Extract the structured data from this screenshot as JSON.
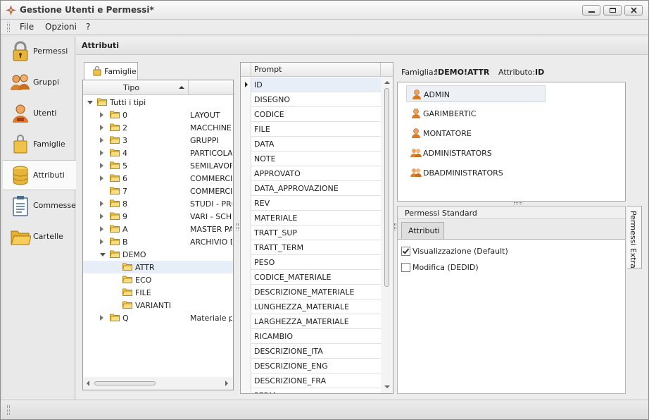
{
  "window": {
    "title": "Gestione Utenti e Permessi*"
  },
  "menu": [
    "File",
    "Opzioni",
    "?"
  ],
  "sidebar": {
    "items": [
      {
        "label": "Permessi",
        "icon": "lock-icon"
      },
      {
        "label": "Gruppi",
        "icon": "group-icon"
      },
      {
        "label": "Utenti",
        "icon": "user-icon"
      },
      {
        "label": "Famiglie",
        "icon": "family-icon"
      },
      {
        "label": "Attributi",
        "icon": "database-icon",
        "active": true
      },
      {
        "label": "Commesse",
        "icon": "clipboard-icon"
      },
      {
        "label": "Cartelle",
        "icon": "folder-icon"
      }
    ]
  },
  "content": {
    "title": "Attributi"
  },
  "tree": {
    "tab_label": "Famiglie",
    "column_label": "Tipo",
    "rows": [
      {
        "code": "Tutti i tipi",
        "desc": "",
        "level": 0,
        "state": "open"
      },
      {
        "code": "0",
        "desc": "LAYOUT",
        "level": 1,
        "state": "closed"
      },
      {
        "code": "2",
        "desc": "MACCHINE",
        "level": 1,
        "state": "closed"
      },
      {
        "code": "3",
        "desc": "GRUPPI",
        "level": 1,
        "state": "closed"
      },
      {
        "code": "4",
        "desc": "PARTICOLARI",
        "level": 1,
        "state": "closed"
      },
      {
        "code": "5",
        "desc": "SEMILAVORATI",
        "level": 1,
        "state": "closed"
      },
      {
        "code": "6",
        "desc": "COMMERCIALI",
        "level": 1,
        "state": "closed"
      },
      {
        "code": "7",
        "desc": "COMMERCIALI",
        "level": 1,
        "state": "none"
      },
      {
        "code": "8",
        "desc": "STUDI - PROGETTI",
        "level": 1,
        "state": "closed"
      },
      {
        "code": "9",
        "desc": "VARI - SCHEMI",
        "level": 1,
        "state": "closed"
      },
      {
        "code": "A",
        "desc": "MASTER PARTS",
        "level": 1,
        "state": "closed"
      },
      {
        "code": "B",
        "desc": "ARCHIVIO DISEGNI",
        "level": 1,
        "state": "closed"
      },
      {
        "code": "DEMO",
        "desc": "",
        "level": 1,
        "state": "open"
      },
      {
        "code": "ATTR",
        "desc": "",
        "level": 2,
        "state": "none",
        "selected": true
      },
      {
        "code": "ECO",
        "desc": "",
        "level": 2,
        "state": "none"
      },
      {
        "code": "FILE",
        "desc": "",
        "level": 2,
        "state": "none"
      },
      {
        "code": "VARIANTI",
        "desc": "",
        "level": 2,
        "state": "none"
      },
      {
        "code": "Q",
        "desc": "Materiale per",
        "level": 1,
        "state": "closed"
      }
    ]
  },
  "grid": {
    "column_label": "Prompt",
    "rows": [
      "ID",
      "DISEGNO",
      "CODICE",
      "FILE",
      "DATA",
      "NOTE",
      "APPROVATO",
      "DATA_APPROVAZIONE",
      "REV",
      "MATERIALE",
      "TRATT_SUP",
      "TRATT_TERM",
      "PESO",
      "CODICE_MATERIALE",
      "DESCRIZIONE_MATERIALE",
      "LUNGHEZZA_MATERIALE",
      "LARGHEZZA_MATERIALE",
      "RICAMBIO",
      "DESCRIZIONE_ITA",
      "DESCRIZIONE_ENG",
      "DESCRIZIONE_FRA",
      "PERM"
    ]
  },
  "info": {
    "family_label": "Famiglia:",
    "family_value": "!DEMO!ATTR",
    "attribute_label": "Attributo:",
    "attribute_value": "ID"
  },
  "users": [
    {
      "name": "ADMIN",
      "type": "user",
      "selected": true
    },
    {
      "name": "GARIMBERTIC",
      "type": "user"
    },
    {
      "name": "MONTATORE",
      "type": "user"
    },
    {
      "name": "ADMINISTRATORS",
      "type": "group"
    },
    {
      "name": "DBADMINISTRATORS",
      "type": "group"
    }
  ],
  "permissions": {
    "panel_title": "Permessi Standard",
    "tab_label": "Attributi",
    "items": [
      {
        "label": "Visualizzazione (Default)",
        "checked": true
      },
      {
        "label": "Modifica (DEDID)",
        "checked": false
      }
    ],
    "extra_tab_label": "Permessi Extra"
  }
}
